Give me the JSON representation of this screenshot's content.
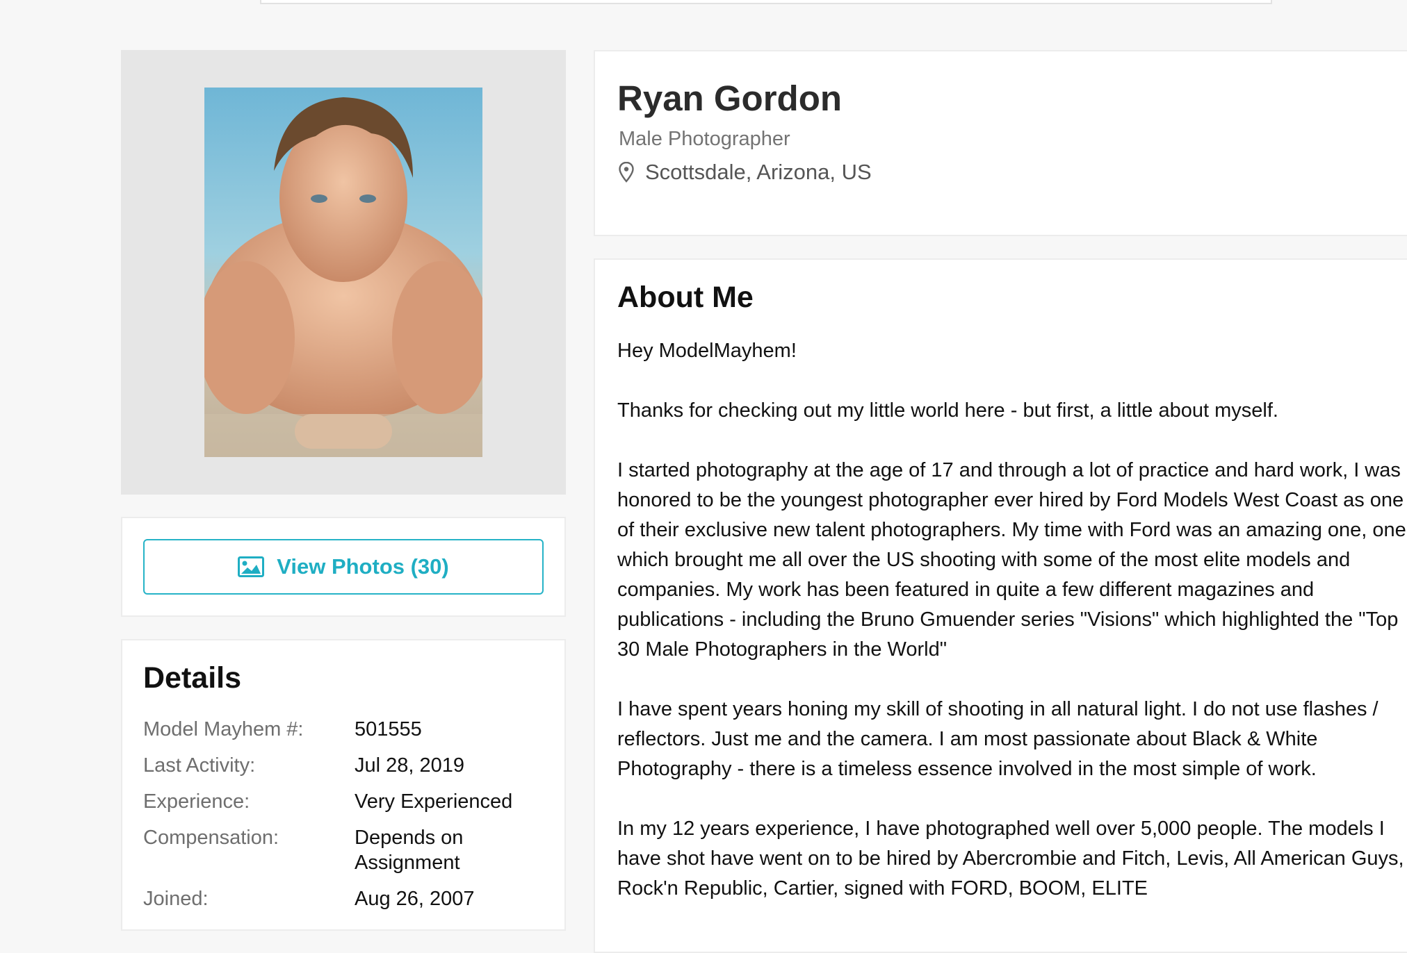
{
  "profile": {
    "name": "Ryan Gordon",
    "role": "Male Photographer",
    "location": "Scottsdale, Arizona, US",
    "photo_alt": "Profile portrait"
  },
  "photos": {
    "view_photos_label": "View Photos (30)"
  },
  "details": {
    "heading": "Details",
    "rows": [
      {
        "label": "Model Mayhem #:",
        "value": "501555"
      },
      {
        "label": "Last Activity:",
        "value": "Jul 28, 2019"
      },
      {
        "label": "Experience:",
        "value": "Very Experienced"
      },
      {
        "label": "Compensation:",
        "value": "Depends on Assignment"
      },
      {
        "label": "Joined:",
        "value": "Aug 26, 2007"
      }
    ]
  },
  "about": {
    "heading": "About Me",
    "paragraphs": [
      "Hey ModelMayhem!",
      "Thanks for checking out my little world here - but first, a little about myself.",
      "I started photography at the age of 17 and through a lot of practice and hard work, I was honored to be the youngest photographer ever hired by Ford Models West Coast as one of their exclusive new talent photographers.  My time with Ford was an amazing one, one which brought me all over the US shooting with some of the most elite models and companies.  My work has been featured in quite a few different magazines and publications - including the Bruno Gmuender series \"Visions\" which highlighted the \"Top 30 Male Photographers in the World\"",
      "I have spent years honing my skill of shooting in all natural light.  I do not use flashes / reflectors.  Just me and the camera.  I am most passionate about Black & White Photography - there is a timeless essence involved in the most simple of work.",
      "In my 12 years experience, I have photographed well over 5,000 people.  The models I have shot have went on to be hired by Abercrombie and Fitch, Levis, All American Guys, Rock'n Republic, Cartier, signed with  FORD, BOOM, ELITE"
    ]
  },
  "colors": {
    "accent": "#1faec3",
    "label_gray": "#6e6e6e",
    "background": "#f7f7f7"
  },
  "icons": {
    "view_photos": "image-icon",
    "location": "map-pin-icon"
  }
}
